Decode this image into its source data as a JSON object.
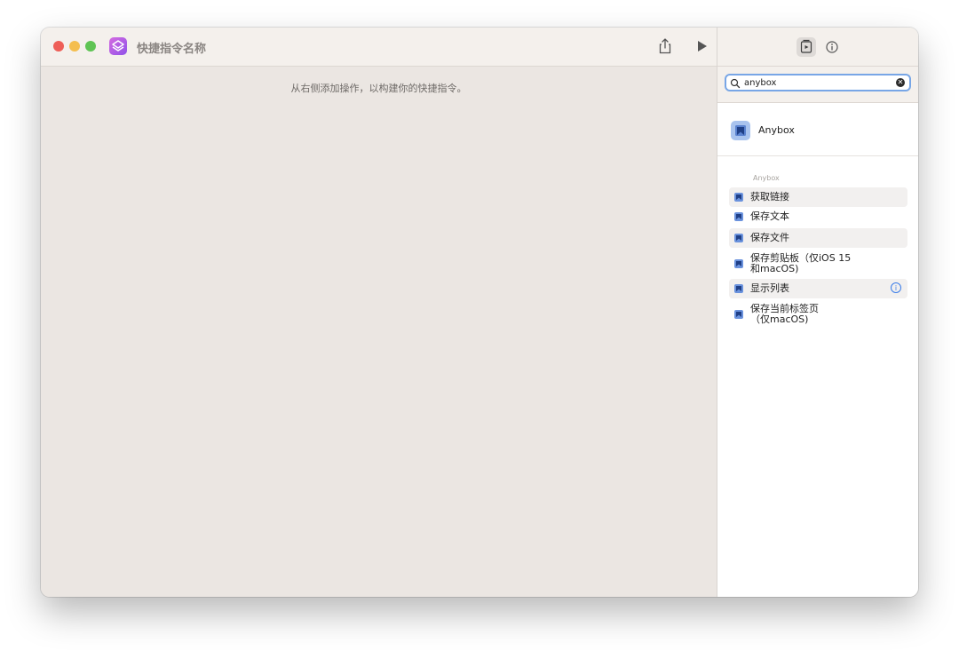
{
  "window": {
    "title": "快捷指令名称",
    "hint": "从右侧添加操作，以构建你的快捷指令。"
  },
  "icons": {
    "app": "shortcuts-icon",
    "share": "share-icon",
    "run": "play-icon",
    "library": "action-library-icon",
    "details": "info-icon",
    "search": "search-icon",
    "clear": "clear-icon"
  },
  "search": {
    "value": "anybox",
    "clear_label": "✕"
  },
  "results": {
    "app_name": "Anybox",
    "section_label": "Anybox",
    "actions": [
      {
        "label": "获取链接"
      },
      {
        "label": "保存文本"
      },
      {
        "label": "保存文件"
      },
      {
        "label": "保存剪贴板（仅iOS 15\n和macOS)"
      },
      {
        "label": "显示列表"
      },
      {
        "label": "保存当前标签页\n（仅macOS)"
      }
    ],
    "info_glyph": "i"
  },
  "colors": {
    "accent": "#3a7ce9",
    "app_icon": "#6a92dd",
    "close": "#ee5e57",
    "minimize": "#f4be4f",
    "maximize": "#5fc454"
  }
}
